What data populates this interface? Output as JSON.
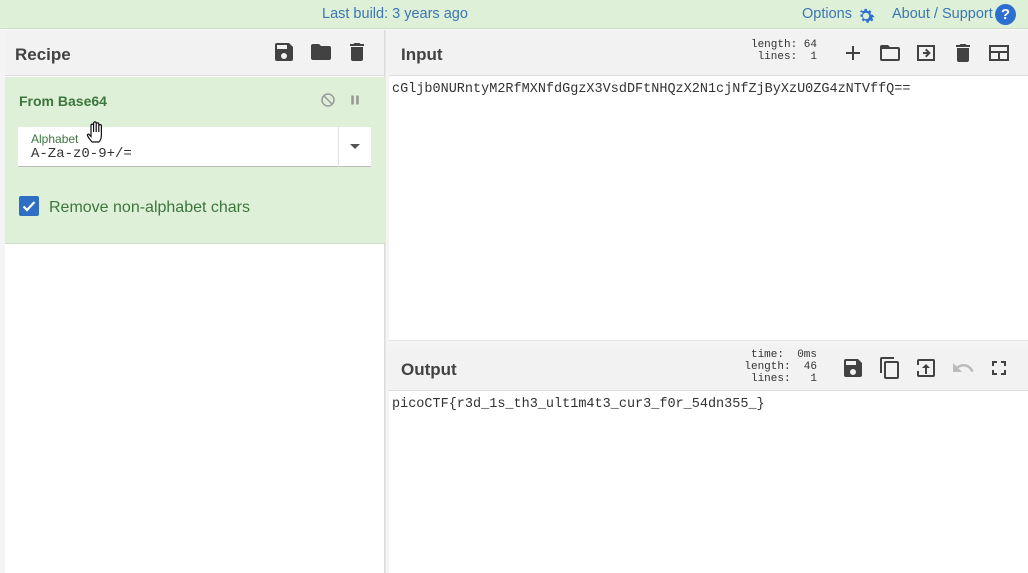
{
  "banner": {
    "last_build": "Last build: 3 years ago",
    "options": "Options",
    "about": "About / Support",
    "help_glyph": "?"
  },
  "recipe": {
    "title": "Recipe",
    "tools": [
      "save-icon",
      "folder-icon",
      "trash-icon"
    ],
    "operation": {
      "name": "From Base64",
      "alphabet_label": "Alphabet",
      "alphabet_value": "A-Za-z0-9+/=",
      "remove_label": "Remove non-alphabet chars",
      "remove_checked": true
    }
  },
  "input": {
    "title": "Input",
    "length_label": "length:",
    "length_value": "64",
    "lines_label": "lines:",
    "lines_value": "1",
    "text": "cGljb0NURntyM2RfMXNfdGgzX3VsdDFtNHQzX2N1cjNfZjByXzU0ZG4zNTVffQ=="
  },
  "output": {
    "title": "Output",
    "time_label": "time:",
    "time_value": "0ms",
    "length_label": "length:",
    "length_value": "46",
    "lines_label": "lines:",
    "lines_value": "1",
    "text": "picoCTF{r3d_1s_th3_ult1m4t3_cur3_f0r_54dn355_}"
  },
  "colors": {
    "banner_bg": "#dff0d8",
    "link": "#3b76b5",
    "op_text": "#3c763d",
    "checkbox": "#2e6fc3"
  }
}
